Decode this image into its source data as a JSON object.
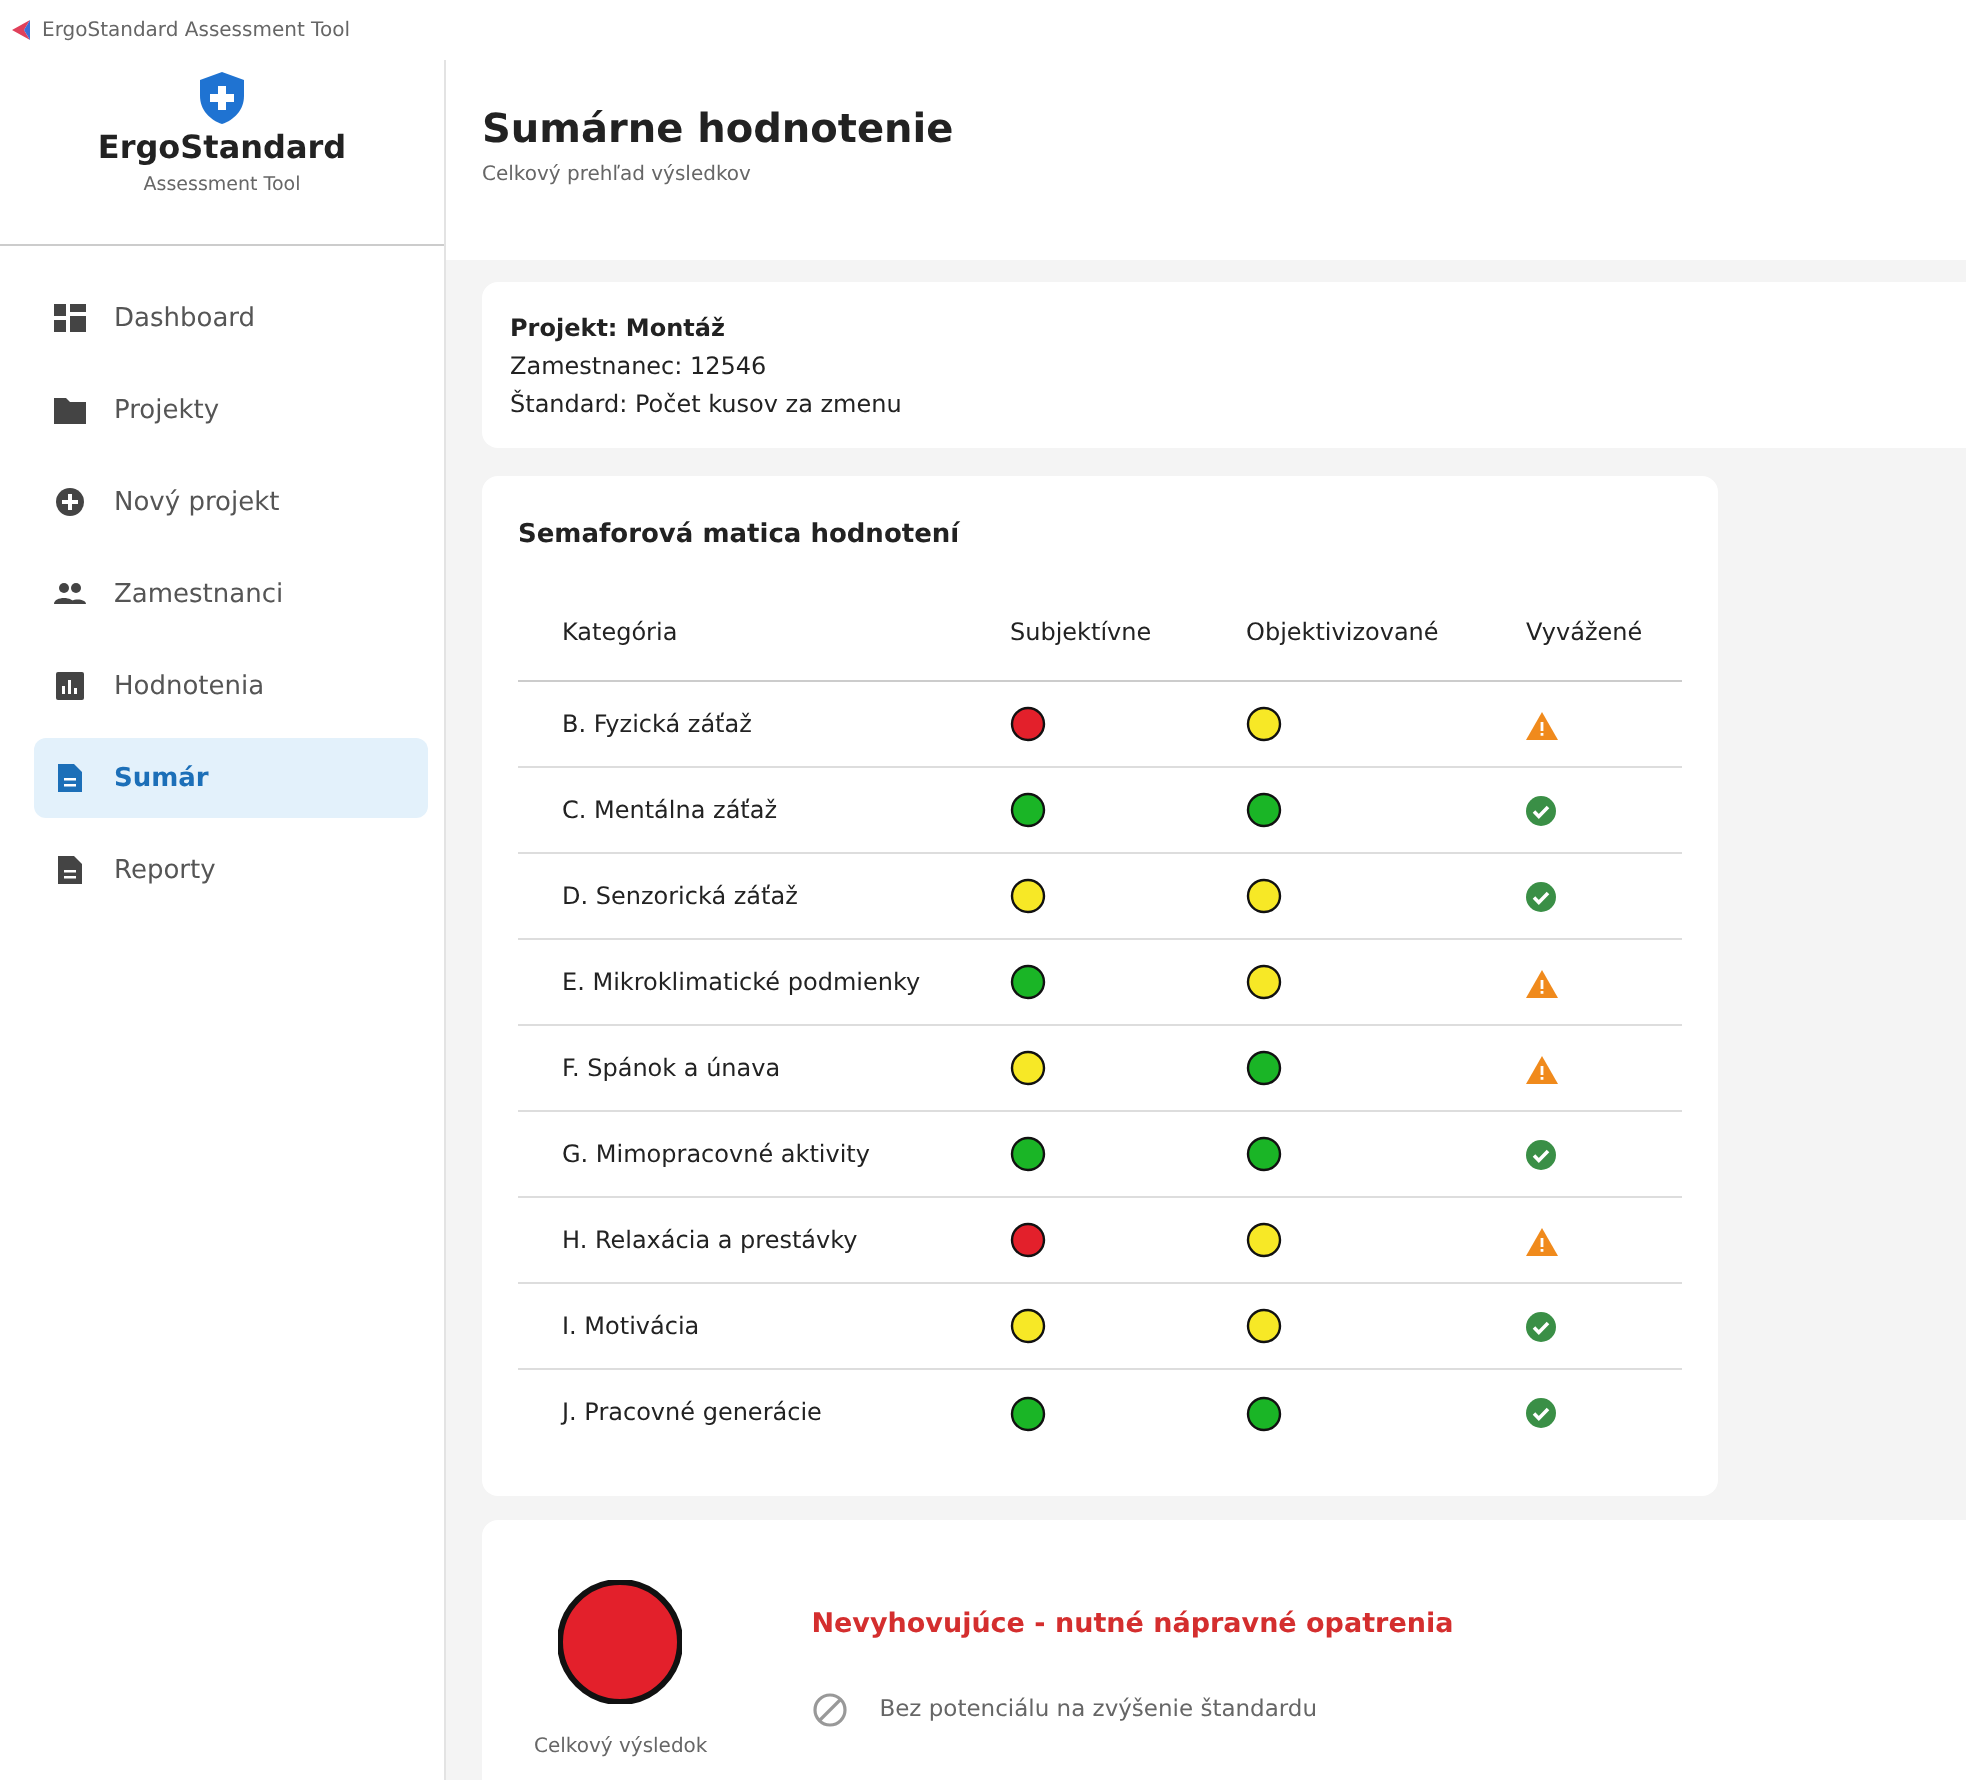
{
  "window": {
    "title": "ErgoStandard Assessment Tool"
  },
  "sidebar": {
    "brand": "ErgoStandard",
    "tagline": "Assessment Tool",
    "items": [
      {
        "label": "Dashboard",
        "selected": false
      },
      {
        "label": "Projekty",
        "selected": false
      },
      {
        "label": "Nový projekt",
        "selected": false
      },
      {
        "label": "Zamestnanci",
        "selected": false
      },
      {
        "label": "Hodnotenia",
        "selected": false
      },
      {
        "label": "Sumár",
        "selected": true
      },
      {
        "label": "Reporty",
        "selected": false
      }
    ]
  },
  "header": {
    "title": "Sumárne hodnotenie",
    "subtitle": "Celkový prehľad výsledkov"
  },
  "info": {
    "project": "Projekt: Montáž",
    "employee": "Zamestnanec: 12546",
    "standard": "Štandard: Počet kusov za zmenu"
  },
  "matrix": {
    "title": "Semaforová matica hodnotení",
    "columns": [
      "Kategória",
      "Subjektívne",
      "Objektivizované",
      "Vyvážené"
    ],
    "rows": [
      {
        "category": "B. Fyzická záťaž",
        "subjective": {
          "color": "#e3202b"
        },
        "objective": {
          "color": "#f7e826"
        },
        "balanced": {
          "kind": "warning"
        }
      },
      {
        "category": "C. Mentálna záťaž",
        "subjective": {
          "color": "#1ab526"
        },
        "objective": {
          "color": "#1ab526"
        },
        "balanced": {
          "kind": "ok"
        }
      },
      {
        "category": "D. Senzorická záťaž",
        "subjective": {
          "color": "#f7e826"
        },
        "objective": {
          "color": "#f7e826"
        },
        "balanced": {
          "kind": "ok"
        }
      },
      {
        "category": "E. Mikroklimatické podmienky",
        "subjective": {
          "color": "#1ab526"
        },
        "objective": {
          "color": "#f7e826"
        },
        "balanced": {
          "kind": "warning"
        }
      },
      {
        "category": "F. Spánok a únava",
        "subjective": {
          "color": "#f7e826"
        },
        "objective": {
          "color": "#1ab526"
        },
        "balanced": {
          "kind": "warning"
        }
      },
      {
        "category": "G. Mimopracovné aktivity",
        "subjective": {
          "color": "#1ab526"
        },
        "objective": {
          "color": "#1ab526"
        },
        "balanced": {
          "kind": "ok"
        }
      },
      {
        "category": "H. Relaxácia a prestávky",
        "subjective": {
          "color": "#e3202b"
        },
        "objective": {
          "color": "#f7e826"
        },
        "balanced": {
          "kind": "warning"
        }
      },
      {
        "category": "I. Motivácia",
        "subjective": {
          "color": "#f7e826"
        },
        "objective": {
          "color": "#f7e826"
        },
        "balanced": {
          "kind": "ok"
        }
      },
      {
        "category": "J. Pracovné generácie",
        "subjective": {
          "color": "#1ab526"
        },
        "objective": {
          "color": "#1ab526"
        },
        "balanced": {
          "kind": "ok"
        }
      }
    ]
  },
  "result": {
    "overall": {
      "color": "#e3202b"
    },
    "caption": "Celkový výsledok",
    "verdict": "Nevyhovujúce - nutné nápravné opatrenia",
    "note": "Bez potenciálu na zvýšenie štandardu"
  }
}
